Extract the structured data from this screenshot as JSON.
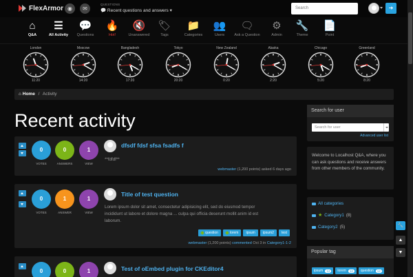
{
  "topbar": {
    "brand": "FlexArmor",
    "questions_label": "QUESTIONS",
    "questions_select": "Recent questions and answers",
    "search_placeholder": "Search",
    "colors": {
      "accent": "#29a3e0",
      "brand_red": "#e53935"
    }
  },
  "nav": [
    {
      "label": "Q&A",
      "icon": "home-icon",
      "glyph": "⌂",
      "active": true
    },
    {
      "label": "All Activity",
      "icon": "list-icon",
      "glyph": "☰",
      "active": true
    },
    {
      "label": "Questions",
      "icon": "comments-icon",
      "glyph": "💬"
    },
    {
      "label": "Hot!",
      "icon": "fire-icon",
      "glyph": "🔥",
      "hot": true
    },
    {
      "label": "Unanswered",
      "icon": "mute-icon",
      "glyph": "🔇"
    },
    {
      "label": "Tags",
      "icon": "tags-icon",
      "glyph": "🏷"
    },
    {
      "label": "Categories",
      "icon": "folder-icon",
      "glyph": "📁"
    },
    {
      "label": "Users",
      "icon": "users-icon",
      "glyph": "👥"
    },
    {
      "label": "Ask a Question",
      "icon": "speech-icon",
      "glyph": "🗨"
    },
    {
      "label": "Admin",
      "icon": "admin-gear-icon",
      "glyph": "⚙"
    },
    {
      "label": "Theme",
      "icon": "wrench-icon",
      "glyph": "🔧"
    },
    {
      "label": "Point",
      "icon": "document-icon",
      "glyph": "📄"
    }
  ],
  "clocks": [
    {
      "city": "London",
      "time": "11:20",
      "h": 11,
      "m": 20,
      "s": 44
    },
    {
      "city": "Moscow",
      "time": "14:20",
      "h": 14,
      "m": 20,
      "s": 44
    },
    {
      "city": "Bangladesh",
      "time": "17:20",
      "h": 17,
      "m": 20,
      "s": 44
    },
    {
      "city": "Tokyo",
      "time": "20:20",
      "h": 20,
      "m": 20,
      "s": 44
    },
    {
      "city": "New Zealand",
      "time": "0:20",
      "h": 0,
      "m": 20,
      "s": 44
    },
    {
      "city": "Alaska",
      "time": "2:20",
      "h": 2,
      "m": 20,
      "s": 44
    },
    {
      "city": "Chicago",
      "time": "5:20",
      "h": 5,
      "m": 20,
      "s": 44
    },
    {
      "city": "Greenland",
      "time": "8:20",
      "h": 8,
      "m": 20,
      "s": 44
    }
  ],
  "breadcrumb": {
    "home": "Home",
    "separator": "/",
    "current": "Activity"
  },
  "page_title": "Recent activity",
  "questions": [
    {
      "title": "dfsdf fdsf sfsa fsadfs f",
      "votes": "0",
      "answers": "0",
      "views": "1",
      "votes_label": "VOTES",
      "answers_label": "ANSWERS",
      "views_label": "VIEW",
      "excerpt": "**fdfdf**",
      "meta_user": "webmaster",
      "meta_points": "(1,200 points)",
      "meta_action": "asked",
      "meta_when": "6 days ago"
    },
    {
      "title": "Title of test question",
      "votes": "0",
      "answers": "1",
      "views": "1",
      "votes_label": "VOTES",
      "answers_label": "ANSWER",
      "views_label": "VIEW",
      "excerpt_line1": "Lorem ipsum dolor sit amet, consectetur adipisicing elit, sed do eiusmod tempor",
      "excerpt_line2": "incididunt ut labore et dolore magna ... culpa qui officia deserunt mollit anim id est",
      "excerpt_line3": "laborum.",
      "tags": [
        "question",
        "lorem",
        "ipsum",
        "ipsum2",
        "test"
      ],
      "meta_user": "webmaster",
      "meta_points": "(1,200 points)",
      "meta_action": "commented",
      "meta_when": "Oct 3 in",
      "meta_category": "Category1-1-2"
    },
    {
      "title": "Test of oEmbed plugin for CKEditor4",
      "votes": "0",
      "answers": "0",
      "views": "1"
    }
  ],
  "sidebar": {
    "search_title": "Search for user",
    "search_placeholder": "Search for user",
    "advanced_link": "Advanced user list",
    "welcome_text": "Welcome to Localhost Q&A, where you can ask questions and receive answers from other members of the community.",
    "categories": [
      {
        "label": "All categories",
        "count": ""
      },
      {
        "label": "Category1",
        "count": "(8)",
        "star": true
      },
      {
        "label": "Category2",
        "count": "(5)"
      }
    ],
    "popular_tag_title": "Popular tag",
    "popular_tags": [
      {
        "label": "ipsum",
        "count": "12"
      },
      {
        "label": "lorem",
        "count": "12"
      },
      {
        "label": "question",
        "count": "12"
      },
      {
        "label": "test",
        "count": "12"
      }
    ]
  }
}
